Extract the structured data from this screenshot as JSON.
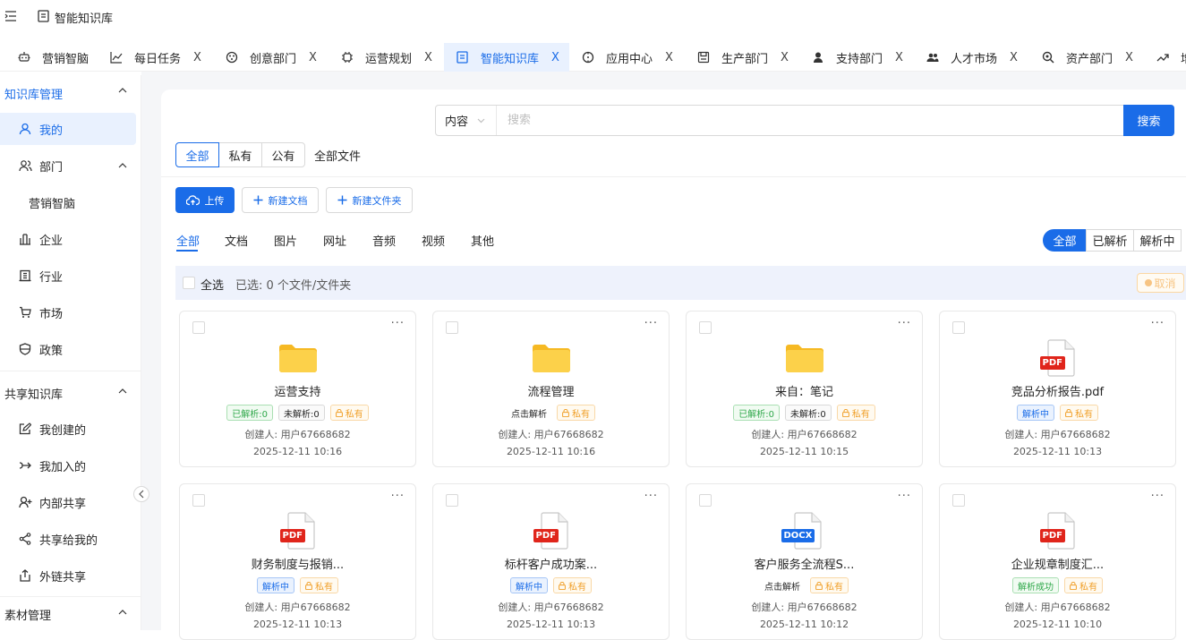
{
  "header": {
    "title": "智能知识库"
  },
  "tabs": [
    {
      "label": "营销智脑",
      "icon": "robot-icon",
      "closable": false,
      "active": false
    },
    {
      "label": "每日任务",
      "icon": "chart-line-icon",
      "closable": true,
      "active": false
    },
    {
      "label": "创意部门",
      "icon": "palette-icon",
      "closable": true,
      "active": false
    },
    {
      "label": "运营规划",
      "icon": "chip-icon",
      "closable": true,
      "active": false
    },
    {
      "label": "智能知识库",
      "icon": "book-icon",
      "closable": true,
      "active": true
    },
    {
      "label": "应用中心",
      "icon": "compass-icon",
      "closable": true,
      "active": false
    },
    {
      "label": "生产部门",
      "icon": "save-icon",
      "closable": true,
      "active": false
    },
    {
      "label": "支持部门",
      "icon": "support-icon",
      "closable": true,
      "active": false
    },
    {
      "label": "人才市场",
      "icon": "team-icon",
      "closable": true,
      "active": false
    },
    {
      "label": "资产部门",
      "icon": "zoom-icon",
      "closable": true,
      "active": false
    },
    {
      "label": "增",
      "icon": "trend-icon",
      "closable": false,
      "active": false
    }
  ],
  "close_glyph": "X",
  "sidebar": {
    "section_knowledge": "知识库管理",
    "mine": "我的",
    "dept": "部门",
    "dept_child": "营销智脑",
    "enterprise": "企业",
    "industry": "行业",
    "market": "市场",
    "policy": "政策",
    "section_shared": "共享知识库",
    "created": "我创建的",
    "joined": "我加入的",
    "internal": "内部共享",
    "shared_to_me": "共享给我的",
    "external": "外链共享",
    "section_material": "素材管理"
  },
  "search": {
    "scope": "内容",
    "placeholder": "搜索",
    "button": "搜索"
  },
  "scope_tabs": {
    "all": "全部",
    "private": "私有",
    "public": "公有",
    "all_files": "全部文件"
  },
  "actions": {
    "upload": "上传",
    "new_doc": "新建文档",
    "new_folder": "新建文件夹"
  },
  "file_tabs": [
    "全部",
    "文档",
    "图片",
    "网址",
    "音频",
    "视频",
    "其他"
  ],
  "parse_filter": [
    "全部",
    "已解析",
    "解析中"
  ],
  "selection": {
    "select_all": "全选",
    "selected": "已选: 0 个文件/文件夹",
    "cancel": "取消"
  },
  "cards": [
    {
      "type": "folder",
      "name": "运营支持",
      "tags": [
        {
          "kind": "ok",
          "text": "已解析:0"
        },
        {
          "kind": "gray",
          "text": "未解析:0"
        },
        {
          "kind": "priv",
          "text": "私有"
        }
      ],
      "creator": "创建人: 用户67668682",
      "time": "2025-12-11 10:16"
    },
    {
      "type": "folder",
      "name": "流程管理",
      "tags": [
        {
          "kind": "plaintag",
          "text": "点击解析"
        },
        {
          "kind": "priv",
          "text": "私有"
        }
      ],
      "creator": "创建人: 用户67668682",
      "time": "2025-12-11 10:16"
    },
    {
      "type": "folder",
      "name": "来自：笔记",
      "tags": [
        {
          "kind": "ok",
          "text": "已解析:0"
        },
        {
          "kind": "gray",
          "text": "未解析:0"
        },
        {
          "kind": "priv",
          "text": "私有"
        }
      ],
      "creator": "创建人: 用户67668682",
      "time": "2025-12-11 10:15"
    },
    {
      "type": "pdf",
      "badge": "PDF",
      "name": "竞品分析报告.pdf",
      "tags": [
        {
          "kind": "parse",
          "text": "解析中"
        },
        {
          "kind": "priv",
          "text": "私有"
        }
      ],
      "creator": "创建人: 用户67668682",
      "time": "2025-12-11 10:13"
    },
    {
      "type": "pdf",
      "badge": "PDF",
      "name": "财务制度与报销...",
      "tags": [
        {
          "kind": "parse",
          "text": "解析中"
        },
        {
          "kind": "priv",
          "text": "私有"
        }
      ],
      "creator": "创建人: 用户67668682",
      "time": "2025-12-11 10:13"
    },
    {
      "type": "pdf",
      "badge": "PDF",
      "name": "标杆客户成功案...",
      "tags": [
        {
          "kind": "parse",
          "text": "解析中"
        },
        {
          "kind": "priv",
          "text": "私有"
        }
      ],
      "creator": "创建人: 用户67668682",
      "time": "2025-12-11 10:13"
    },
    {
      "type": "docx",
      "badge": "DOCX",
      "name": "客户服务全流程S...",
      "tags": [
        {
          "kind": "plaintag",
          "text": "点击解析"
        },
        {
          "kind": "priv",
          "text": "私有"
        }
      ],
      "creator": "创建人: 用户67668682",
      "time": "2025-12-11 10:12"
    },
    {
      "type": "pdf",
      "badge": "PDF",
      "name": "企业规章制度汇...",
      "tags": [
        {
          "kind": "ok",
          "text": "解析成功"
        },
        {
          "kind": "priv",
          "text": "私有"
        }
      ],
      "creator": "创建人: 用户67668682",
      "time": "2025-12-11 10:10"
    }
  ],
  "colors": {
    "accent": "#1a6ce8",
    "pdf_red": "#e0251b",
    "docx_blue": "#1a6ce8",
    "folder": "#fcc53a"
  }
}
